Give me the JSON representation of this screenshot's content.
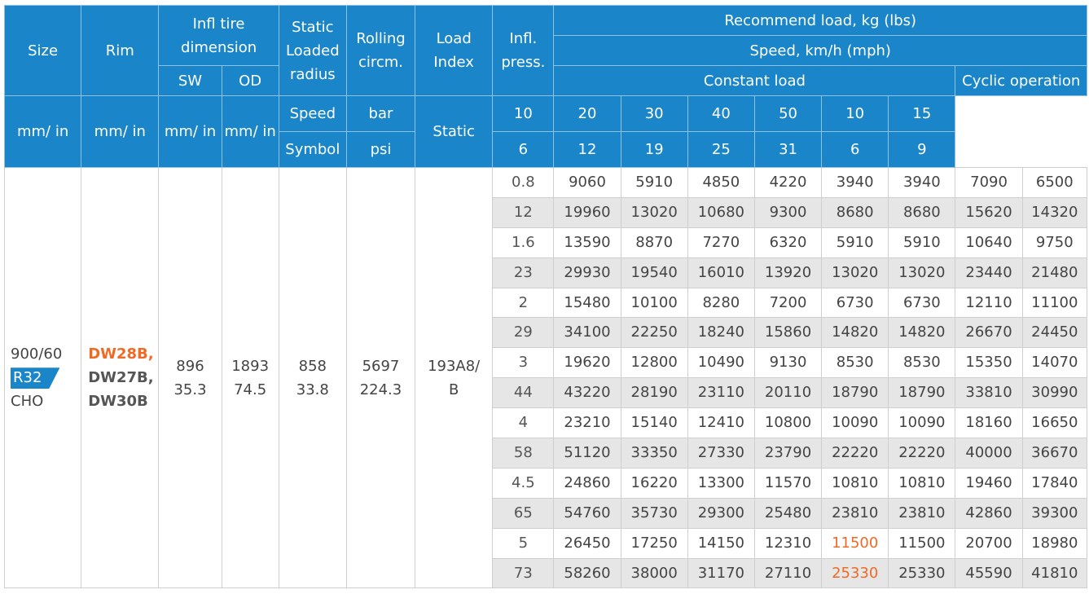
{
  "header": {
    "size": "Size",
    "rim": "Rim",
    "infl_tire_dimension": "Infl tire dimension",
    "sw": "SW",
    "od": "OD",
    "sw_unit": "mm/ in",
    "od_unit": "mm/ in",
    "static_loaded_radius": "Static Loaded radius",
    "slr_unit": "mm/ in",
    "rolling_circm": "Rolling circm.",
    "roll_unit": "mm/ in",
    "load_index": "Load Index",
    "speed": "Speed",
    "symbol": "Symbol",
    "infl_press": "Infl. press.",
    "bar": "bar",
    "psi": "psi",
    "recommend_load": "Recommend load, kg (lbs)",
    "speed_kmh": "Speed, km/h (mph)",
    "constant_load": "Constant load",
    "cyclic_operation": "Cyclic operation",
    "static": "Static",
    "kmh": [
      "10",
      "20",
      "30",
      "40",
      "50",
      "10",
      "15"
    ],
    "mph": [
      "6",
      "12",
      "19",
      "25",
      "31",
      "6",
      "9"
    ]
  },
  "tire": {
    "size_line1": "900/60",
    "size_line2": "R32",
    "size_line3": "CHO",
    "rim_line1": "DW28B,",
    "rim_line2": "DW27B,",
    "rim_line3": "DW30B",
    "sw_mm": "896",
    "sw_in": "35.3",
    "od_mm": "1893",
    "od_in": "74.5",
    "slr_mm": "858",
    "slr_in": "33.8",
    "roll_mm": "5697",
    "roll_in": "224.3",
    "load_index_line1": "193A8/",
    "load_index_line2": "B"
  },
  "rows": [
    {
      "p": "0.8",
      "v": [
        "9060",
        "5910",
        "4850",
        "4220",
        "3940",
        "3940",
        "7090",
        "6500"
      ]
    },
    {
      "p": "12",
      "v": [
        "19960",
        "13020",
        "10680",
        "9300",
        "8680",
        "8680",
        "15620",
        "14320"
      ]
    },
    {
      "p": "1.6",
      "v": [
        "13590",
        "8870",
        "7270",
        "6320",
        "5910",
        "5910",
        "10640",
        "9750"
      ]
    },
    {
      "p": "23",
      "v": [
        "29930",
        "19540",
        "16010",
        "13920",
        "13020",
        "13020",
        "23440",
        "21480"
      ]
    },
    {
      "p": "2",
      "v": [
        "15480",
        "10100",
        "8280",
        "7200",
        "6730",
        "6730",
        "12110",
        "11100"
      ]
    },
    {
      "p": "29",
      "v": [
        "34100",
        "22250",
        "18240",
        "15860",
        "14820",
        "14820",
        "26670",
        "24450"
      ]
    },
    {
      "p": "3",
      "v": [
        "19620",
        "12800",
        "10490",
        "9130",
        "8530",
        "8530",
        "15350",
        "14070"
      ]
    },
    {
      "p": "44",
      "v": [
        "43220",
        "28190",
        "23110",
        "20110",
        "18790",
        "18790",
        "33810",
        "30990"
      ]
    },
    {
      "p": "4",
      "v": [
        "23210",
        "15140",
        "12410",
        "10800",
        "10090",
        "10090",
        "18160",
        "16650"
      ]
    },
    {
      "p": "58",
      "v": [
        "51120",
        "33350",
        "27330",
        "23790",
        "22220",
        "22220",
        "40000",
        "36670"
      ]
    },
    {
      "p": "4.5",
      "v": [
        "24860",
        "16220",
        "13300",
        "11570",
        "10810",
        "10810",
        "19460",
        "17840"
      ]
    },
    {
      "p": "65",
      "v": [
        "54760",
        "35730",
        "29300",
        "25480",
        "23810",
        "23810",
        "42860",
        "39300"
      ]
    },
    {
      "p": "5",
      "v": [
        "26450",
        "17250",
        "14150",
        "12310",
        "11500",
        "11500",
        "20700",
        "18980"
      ]
    },
    {
      "p": "73",
      "v": [
        "58260",
        "38000",
        "31170",
        "27110",
        "25330",
        "25330",
        "45590",
        "41810"
      ]
    }
  ],
  "colors": {
    "header_bg": "#1a86c9",
    "highlight": "#f06a25",
    "row_shade": "#e6e6e6"
  }
}
